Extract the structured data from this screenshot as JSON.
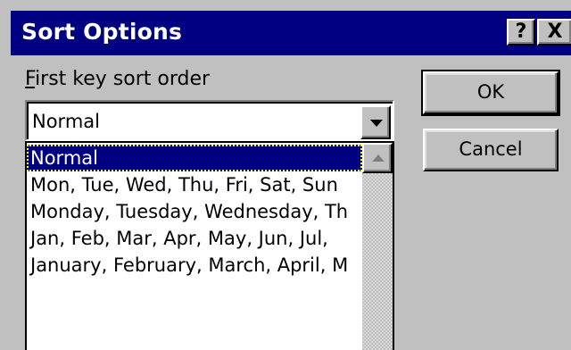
{
  "window": {
    "title": "Sort Options",
    "help_label": "?",
    "close_label": "X"
  },
  "first_key": {
    "label_accel": "F",
    "label_rest": "irst key sort order",
    "selected_value": "Normal",
    "options": [
      "Normal",
      "Mon, Tue, Wed, Thu, Fri, Sat, Sun",
      "Monday, Tuesday, Wednesday, Th",
      "Jan, Feb, Mar, Apr, May, Jun, Jul,",
      "January, February, March, April, M"
    ]
  },
  "buttons": {
    "ok": "OK",
    "cancel": "Cancel"
  },
  "icons": {
    "dropdown": "chevron-down-icon",
    "scroll_up": "arrow-up-icon"
  },
  "colors": {
    "face": "#c0c0c0",
    "titlebar": "#000080",
    "selection": "#000080"
  }
}
